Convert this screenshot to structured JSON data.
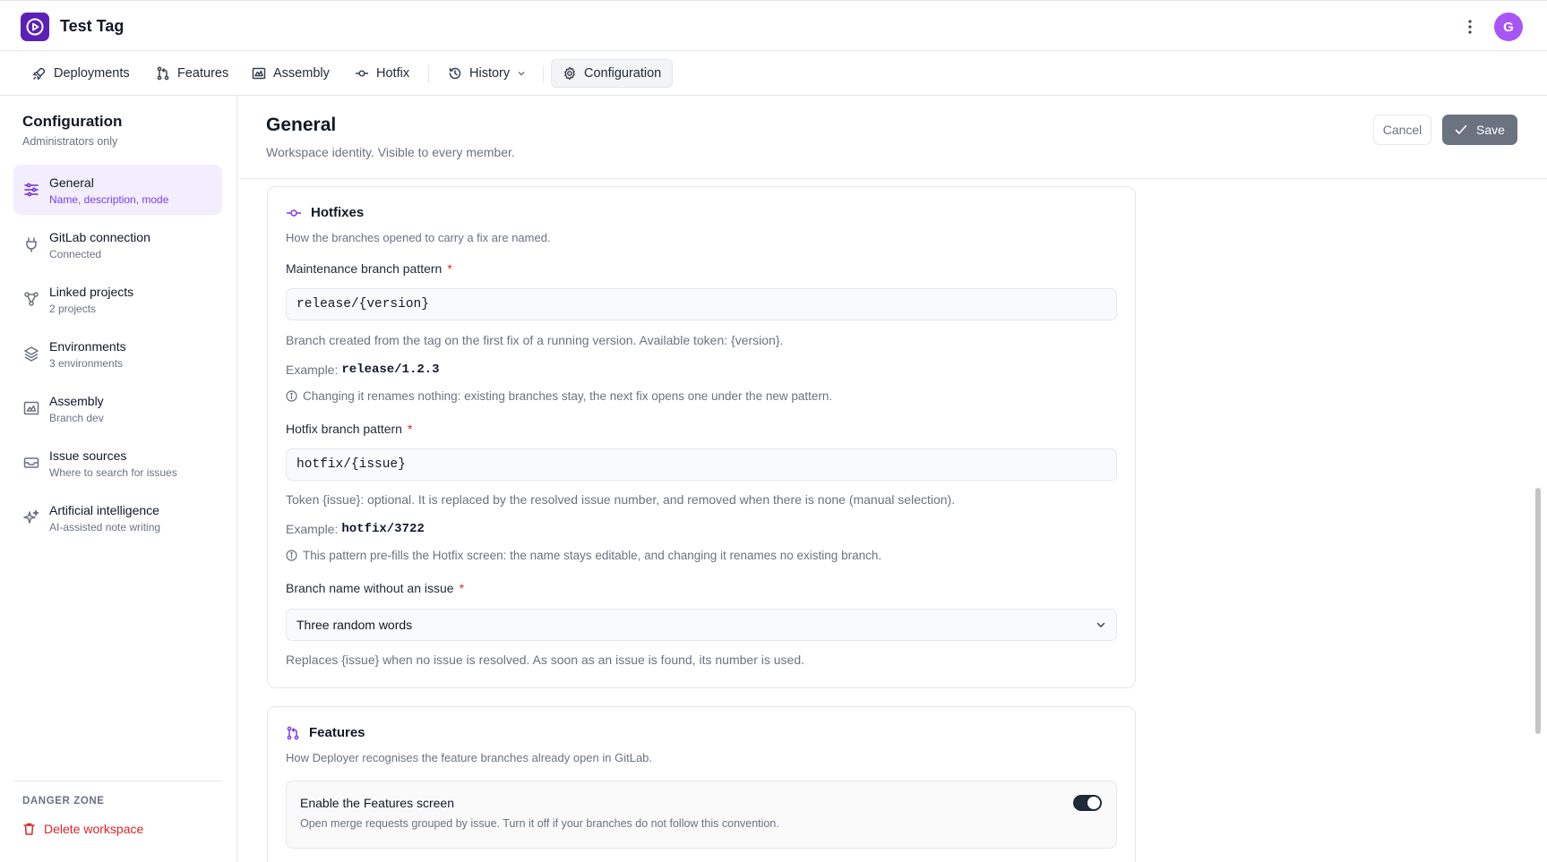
{
  "app": {
    "title": "Test Tag",
    "avatar_initial": "G"
  },
  "nav": [
    {
      "label": "Deployments",
      "icon": "rocket-icon"
    },
    {
      "label": "Features",
      "icon": "git-pull-request-icon"
    },
    {
      "label": "Assembly",
      "icon": "assembly-icon"
    },
    {
      "label": "Hotfix",
      "icon": "git-commit-icon"
    },
    {
      "label": "History",
      "icon": "history-icon"
    },
    {
      "label": "Configuration",
      "icon": "gear-icon",
      "active": true
    }
  ],
  "sidebar": {
    "title": "Configuration",
    "subtitle": "Administrators only",
    "items": [
      {
        "label": "General",
        "desc": "Name, description, mode",
        "icon": "sliders-icon",
        "active": true
      },
      {
        "label": "GitLab connection",
        "desc": "Connected",
        "icon": "plug-icon"
      },
      {
        "label": "Linked projects",
        "desc": "2 projects",
        "icon": "network-icon"
      },
      {
        "label": "Environments",
        "desc": "3 environments",
        "icon": "layers-icon"
      },
      {
        "label": "Assembly",
        "desc": "Branch dev",
        "icon": "assembly-icon"
      },
      {
        "label": "Issue sources",
        "desc": "Where to search for issues",
        "icon": "inbox-icon"
      },
      {
        "label": "Artificial intelligence",
        "desc": "AI-assisted note writing",
        "icon": "sparkles-icon"
      }
    ],
    "danger_title": "DANGER ZONE",
    "danger_action": "Delete workspace"
  },
  "main": {
    "title": "General",
    "subtitle": "Workspace identity. Visible to every member.",
    "cancel_label": "Cancel",
    "save_label": "Save"
  },
  "hotfixes": {
    "title": "Hotfixes",
    "desc": "How the branches opened to carry a fix are named.",
    "maintenance": {
      "label": "Maintenance branch pattern",
      "value": "release/{version}",
      "help": "Branch created from the tag on the first fix of a running version. Available token: {version}.",
      "example_label": "Example:",
      "example_value": "release/1.2.3",
      "note": "Changing it renames nothing: existing branches stay, the next fix opens one under the new pattern."
    },
    "hotfix": {
      "label": "Hotfix branch pattern",
      "value": "hotfix/{issue}",
      "help": "Token {issue}: optional. It is replaced by the resolved issue number, and removed when there is none (manual selection).",
      "example_label": "Example:",
      "example_value": "hotfix/3722",
      "note": "This pattern pre-fills the Hotfix screen: the name stays editable, and changing it renames no existing branch."
    },
    "no_issue": {
      "label": "Branch name without an issue",
      "value": "Three random words",
      "help": "Replaces {issue} when no issue is resolved. As soon as an issue is found, its number is used."
    }
  },
  "features": {
    "title": "Features",
    "desc": "How Deployer recognises the feature branches already open in GitLab.",
    "toggle_title": "Enable the Features screen",
    "toggle_desc": "Open merge requests grouped by issue. Turn it off if your branches do not follow this convention.",
    "toggle_on": true
  },
  "colors": {
    "accent": "#7c3aed",
    "danger": "#dc2626",
    "logo": "#5b21b6",
    "avatar": "#a855f7"
  }
}
